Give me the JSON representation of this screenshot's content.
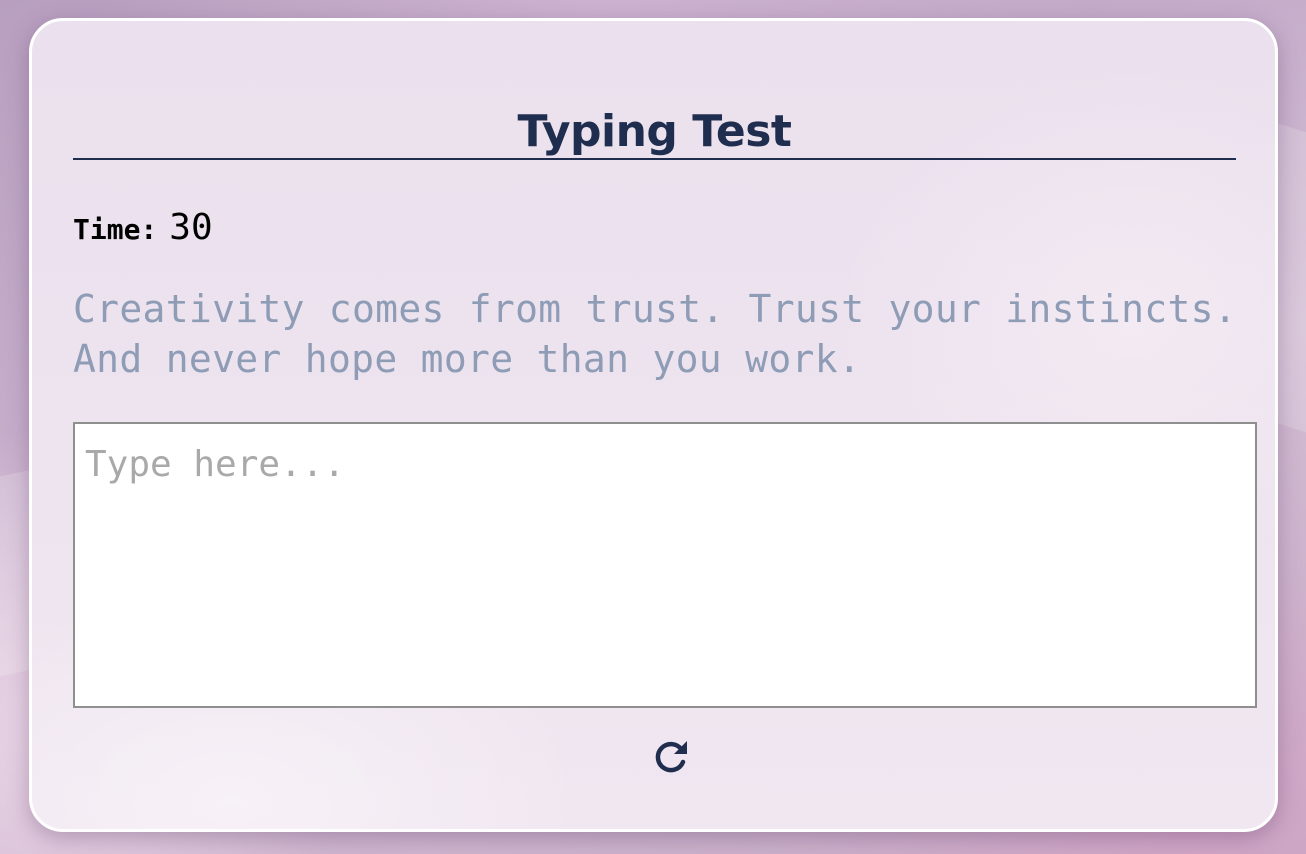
{
  "app": {
    "title": "Typing Test"
  },
  "timer": {
    "label": "Time:",
    "value": "30"
  },
  "quote": {
    "text": "Creativity comes from trust. Trust your instincts. And never hope more than you work."
  },
  "input": {
    "placeholder": "Type here...",
    "value": ""
  },
  "controls": {
    "restart_icon": "rotate-right-icon"
  },
  "colors": {
    "title": "#1f2d4f",
    "quote": "#8e9cb5",
    "card_border": "#ffffff"
  }
}
